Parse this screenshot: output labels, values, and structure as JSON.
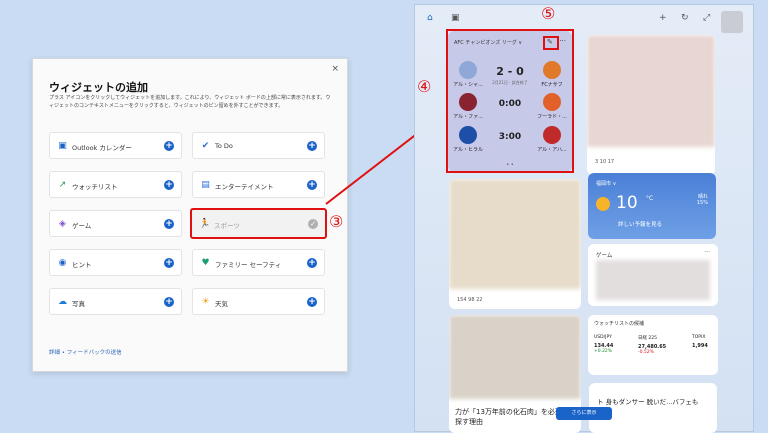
{
  "dialog": {
    "title": "ウィジェットの追加",
    "description": "プラス アイコンをクリックしてウィジェットを追加します。これにより、ウィジェット ボードの上部に常に表示されます。ウィジェットのコンテキストメニューをクリックすると、ウィジェットのピン留めを外すことができます。",
    "close_icon": "×",
    "tiles": [
      {
        "label": "Outlook カレンダー",
        "icon": "outlook-icon",
        "selected": false
      },
      {
        "label": "To Do",
        "icon": "todo-icon",
        "selected": false
      },
      {
        "label": "ウォッチリスト",
        "icon": "watchlist-icon",
        "selected": false
      },
      {
        "label": "エンターテイメント",
        "icon": "entertainment-icon",
        "selected": false
      },
      {
        "label": "ゲーム",
        "icon": "game-icon",
        "selected": false
      },
      {
        "label": "スポーツ",
        "icon": "sports-icon",
        "selected": true
      },
      {
        "label": "ヒント",
        "icon": "tips-icon",
        "selected": false
      },
      {
        "label": "ファミリー セーフティ",
        "icon": "family-safety-icon",
        "selected": false
      },
      {
        "label": "写真",
        "icon": "photos-icon",
        "selected": false
      },
      {
        "label": "天気",
        "icon": "weather-icon",
        "selected": false
      }
    ],
    "footer": "詳細 • フィードバックの送信"
  },
  "annotations": {
    "n3": "③",
    "n4": "④",
    "n5": "⑤"
  },
  "panel": {
    "sports": {
      "header": "AFC チャンピオンズ リーグ ∨",
      "more": "···",
      "matches": [
        {
          "home": "アル・シャ...",
          "away": "FCナサフ",
          "score": "2 - 0",
          "sub": "2月21日 · 試合終了"
        },
        {
          "home": "アル・ファ...",
          "away": "フーラド・...",
          "score": "0:00",
          "sub": ""
        },
        {
          "home": "アル・ヒラル",
          "away": "アル・アハ...",
          "score": "3:00",
          "sub": ""
        }
      ],
      "dots": "• •"
    },
    "weather": {
      "location": "福岡市 ∨",
      "temp": "10",
      "unit": "°C",
      "condition": "晴れ",
      "precip": "15%",
      "link": "詳しい予報を見る"
    },
    "game": {
      "title": "ゲーム",
      "more": "···"
    },
    "stocks": {
      "title": "ウォッチリストの候補",
      "items": [
        {
          "name": "USD/JPY",
          "value": "134.44",
          "change": "+0.22%",
          "up": true
        },
        {
          "name": "日経 225",
          "value": "27,480.65",
          "change": "-0.52%",
          "up": false
        },
        {
          "name": "TOPIX",
          "value": "1,994",
          "change": "",
          "up": true
        }
      ]
    },
    "news": {
      "left_bottom": "力が「13万年前の化石肉」を必死で探す理由",
      "right_bottom": "ト 身もダンサー 脱いだ...バフェも",
      "reactions_1": "154  98  22",
      "reactions_2": "3  10  17"
    },
    "more_button": "さらに表示"
  }
}
